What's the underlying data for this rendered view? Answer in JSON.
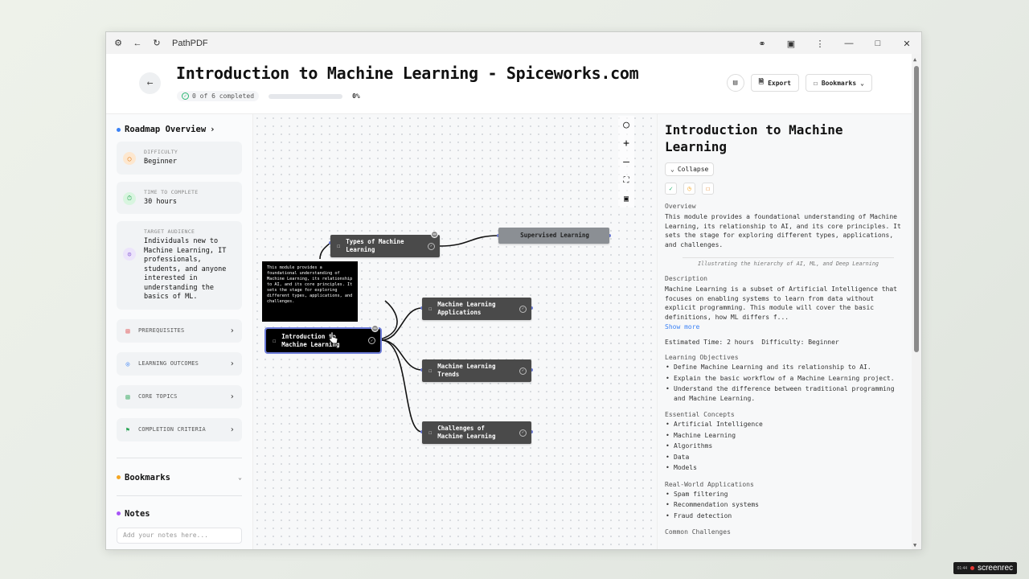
{
  "browser": {
    "app_title": "PathPDF"
  },
  "header": {
    "title": "Introduction to Machine Learning - Spiceworks.com",
    "completed_text": "0 of 6 completed",
    "progress_fraction": 0,
    "progress_pct": "0%",
    "export_label": "Export",
    "bookmarks_label": "Bookmarks"
  },
  "sidebar": {
    "overview_title": "Roadmap Overview",
    "difficulty": {
      "label": "DIFFICULTY",
      "value": "Beginner"
    },
    "time": {
      "label": "TIME TO COMPLETE",
      "value": "30 hours"
    },
    "audience": {
      "label": "TARGET AUDIENCE",
      "value": "Individuals new to Machine Learning, IT professionals, students, and anyone interested in understanding the basics of ML."
    },
    "nav": [
      "PREREQUISITES",
      "LEARNING OUTCOMES",
      "CORE TOPICS",
      "COMPLETION CRITERIA"
    ],
    "bookmarks_title": "Bookmarks",
    "notes_title": "Notes",
    "notes_placeholder": "Add your notes here..."
  },
  "graph": {
    "nodes": {
      "root": "Introduction to Machine Learning",
      "types": "Types of Machine Learning",
      "supervised": "Supervised Learning",
      "applications": "Machine Learning Applications",
      "trends": "Machine Learning Trends",
      "challenges": "Challenges of Machine Learning"
    },
    "tooltip": "This module provides a foundational understanding of Machine Learning, its relationship to AI, and its core principles. It sets the stage for exploring different types, applications, and challenges."
  },
  "detail": {
    "title": "Introduction to Machine Learning",
    "collapse_label": "Collapse",
    "overview_label": "Overview",
    "overview_text": "This module provides a foundational understanding of Machine Learning, its relationship to AI, and its core principles. It sets the stage for exploring different types, applications, and challenges.",
    "caption": "Illustrating the hierarchy of AI, ML, and Deep Learning",
    "description_label": "Description",
    "description_text": "Machine Learning is a subset of Artificial Intelligence that focuses on enabling systems to learn from data without explicit programming. This module will cover the basic definitions, how ML differs f...",
    "show_more": "Show more",
    "estimated_time": "Estimated Time: 2 hours",
    "difficulty": "Difficulty: Beginner",
    "objectives_label": "Learning Objectives",
    "objectives": [
      "Define Machine Learning and its relationship to AI.",
      "Explain the basic workflow of a Machine Learning project.",
      "Understand the difference between traditional programming and Machine Learning."
    ],
    "concepts_label": "Essential Concepts",
    "concepts": [
      "Artificial Intelligence",
      "Machine Learning",
      "Algorithms",
      "Data",
      "Models"
    ],
    "applications_label": "Real-World Applications",
    "applications": [
      "Spam filtering",
      "Recommendation systems",
      "Fraud detection"
    ],
    "challenges_label": "Common Challenges"
  },
  "recorder": {
    "time": "01:44",
    "brand": "screenrec"
  }
}
